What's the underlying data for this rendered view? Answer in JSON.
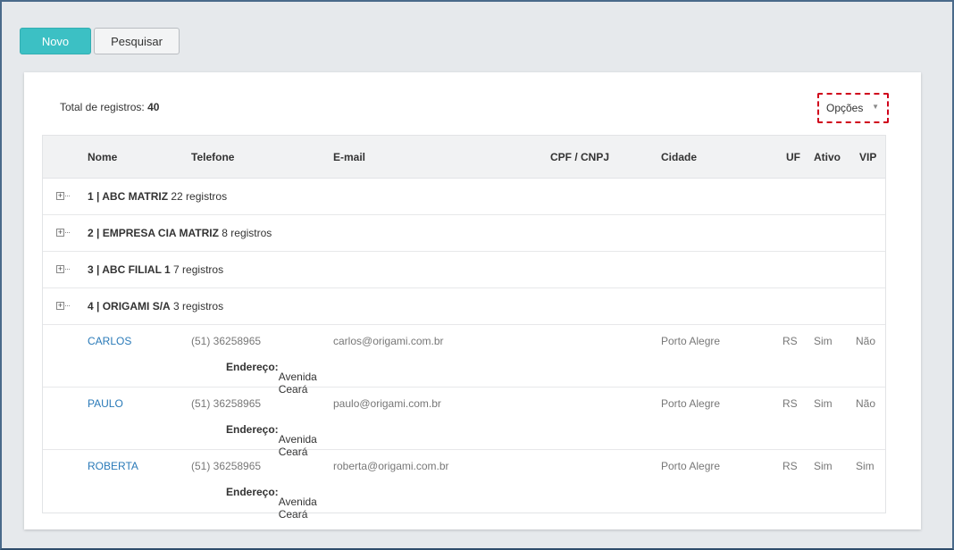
{
  "toolbar": {
    "new_label": "Novo",
    "search_label": "Pesquisar"
  },
  "summary": {
    "total_label": "Total de registros:",
    "total_value": "40"
  },
  "options": {
    "label": "Opções",
    "caret": "▼"
  },
  "table": {
    "headers": {
      "nome": "Nome",
      "telefone": "Telefone",
      "email": "E-mail",
      "cpf": "CPF / CNPJ",
      "cidade": "Cidade",
      "uf": "UF",
      "ativo": "Ativo",
      "vip": "VIP"
    },
    "groups": [
      {
        "title": "1 | ABC MATRIZ",
        "count": "22 registros"
      },
      {
        "title": "2 | EMPRESA CIA MATRIZ",
        "count": "8 registros"
      },
      {
        "title": "3 | ABC FILIAL 1",
        "count": "7 registros"
      },
      {
        "title": "4 | ORIGAMI S/A",
        "count": "3 registros"
      }
    ],
    "address_label": "Endereço:",
    "rows": [
      {
        "nome": "CARLOS",
        "telefone": "(51) 36258965",
        "email": "carlos@origami.com.br",
        "cidade": "Porto Alegre",
        "uf": "RS",
        "ativo": "Sim",
        "vip": "Não",
        "endereco": "Avenida Ceará"
      },
      {
        "nome": "PAULO",
        "telefone": "(51) 36258965",
        "email": "paulo@origami.com.br",
        "cidade": "Porto Alegre",
        "uf": "RS",
        "ativo": "Sim",
        "vip": "Não",
        "endereco": "Avenida Ceará"
      },
      {
        "nome": "ROBERTA",
        "telefone": "(51) 36258965",
        "email": "roberta@origami.com.br",
        "cidade": "Porto Alegre",
        "uf": "RS",
        "ativo": "Sim",
        "vip": "Sim",
        "endereco": "Avenida Ceará"
      }
    ]
  },
  "colors": {
    "primary": "#3cc0c4",
    "link": "#2a7ab8",
    "highlight": "#d0021b"
  }
}
